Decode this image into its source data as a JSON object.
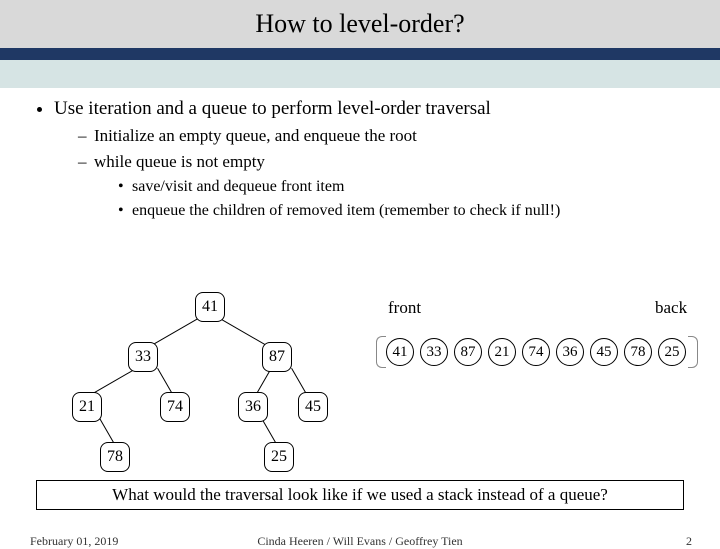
{
  "title": "How to level-order?",
  "bullets": {
    "main": "Use iteration and a queue to perform level-order traversal",
    "sub1": "Initialize an empty queue, and enqueue the root",
    "sub2": "while queue is not empty",
    "subsub1": "save/visit and dequeue front item",
    "subsub2": "enqueue the children of removed item (remember to check if null!)"
  },
  "tree": {
    "n0": "41",
    "n1": "33",
    "n2": "87",
    "n3": "21",
    "n4": "74",
    "n5": "36",
    "n6": "45",
    "n7": "78",
    "n8": "25"
  },
  "queue": {
    "front_label": "front",
    "back_label": "back",
    "items": {
      "i0": "41",
      "i1": "33",
      "i2": "87",
      "i3": "21",
      "i4": "74",
      "i5": "36",
      "i6": "45",
      "i7": "78",
      "i8": "25"
    }
  },
  "question": "What would the traversal look like if we used a stack instead of a queue?",
  "footer": {
    "date": "February 01, 2019",
    "credits": "Cinda Heeren / Will Evans / Geoffrey Tien",
    "page": "2"
  }
}
